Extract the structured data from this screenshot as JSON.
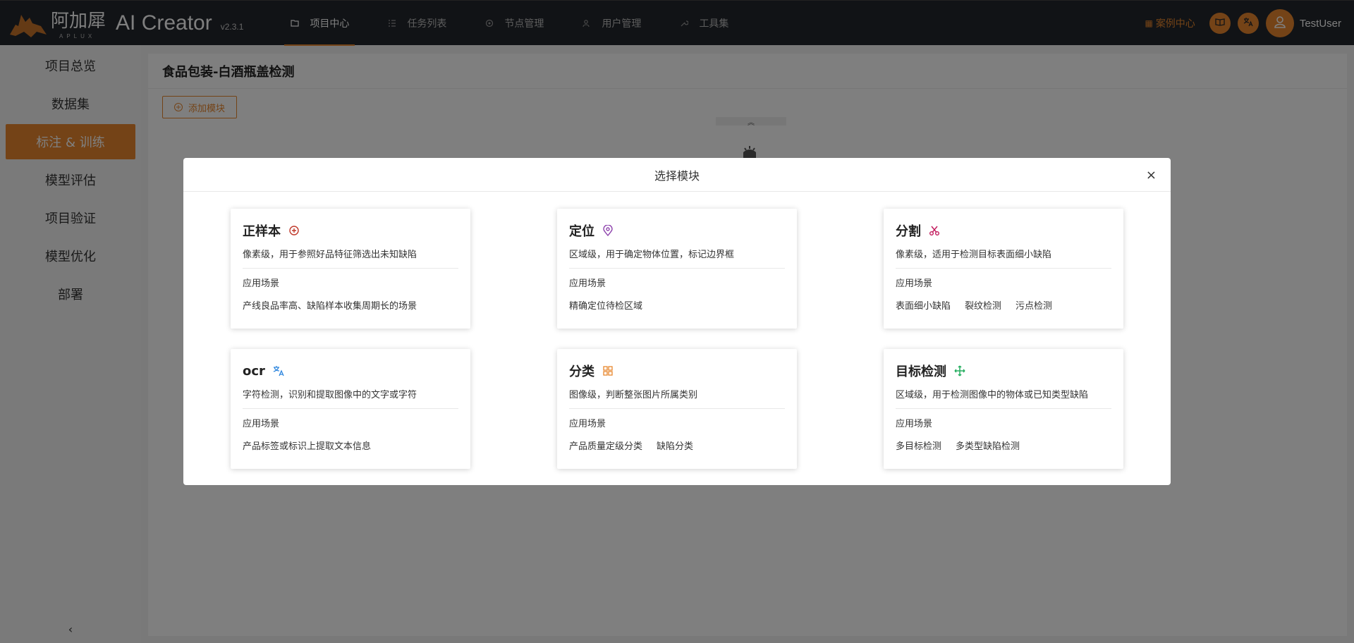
{
  "header": {
    "logo_cn": "阿加犀",
    "logo_sub": "APLUX",
    "app_name": "AI Creator",
    "version": "v2.3.1",
    "nav": [
      {
        "label": "项目中心",
        "icon": "folder-icon",
        "active": true
      },
      {
        "label": "任务列表",
        "icon": "list-icon",
        "active": false
      },
      {
        "label": "节点管理",
        "icon": "node-icon",
        "active": false
      },
      {
        "label": "用户管理",
        "icon": "users-icon",
        "active": false
      },
      {
        "label": "工具集",
        "icon": "wrench-icon",
        "active": false
      }
    ],
    "case_center": "案例中心",
    "username": "TestUser"
  },
  "sidebar": {
    "items": [
      {
        "label": "项目总览",
        "active": false
      },
      {
        "label": "数据集",
        "active": false
      },
      {
        "label": "标注 & 训练",
        "active": true
      },
      {
        "label": "模型评估",
        "active": false
      },
      {
        "label": "项目验证",
        "active": false
      },
      {
        "label": "模型优化",
        "active": false
      },
      {
        "label": "部署",
        "active": false
      }
    ],
    "collapse_glyph": "‹"
  },
  "main": {
    "title": "食品包装-白酒瓶盖检测",
    "add_button": "添加模块"
  },
  "modal": {
    "title": "选择模块",
    "close": "×",
    "scene_label": "应用场景",
    "cards": [
      {
        "title": "正样本",
        "icon": "plus-circle-icon",
        "icon_color": "#c0392b",
        "desc": "像素级，用于参照好品特征筛选出未知缺陷",
        "tags": [
          "产线良品率高、缺陷样本收集周期长的场景"
        ]
      },
      {
        "title": "定位",
        "icon": "location-pin-icon",
        "icon_color": "#8e44ad",
        "desc": "区域级，用于确定物体位置，标记边界框",
        "tags": [
          "精确定位待检区域"
        ]
      },
      {
        "title": "分割",
        "icon": "scissors-icon",
        "icon_color": "#c2185b",
        "desc": "像素级，适用于检测目标表面细小缺陷",
        "tags": [
          "表面细小缺陷",
          "裂纹检测",
          "污点检测"
        ]
      },
      {
        "title": "ocr",
        "icon": "translate-icon",
        "icon_color": "#2e86de",
        "desc": "字符检测，识别和提取图像中的文字或字符",
        "tags": [
          "产品标签或标识上提取文本信息"
        ]
      },
      {
        "title": "分类",
        "icon": "grid-icon",
        "icon_color": "#e8872e",
        "desc": "图像级，判断整张图片所属类别",
        "tags": [
          "产品质量定级分类",
          "缺陷分类"
        ]
      },
      {
        "title": "目标检测",
        "icon": "move-arrows-icon",
        "icon_color": "#27ae60",
        "desc": "区域级，用于检测图像中的物体或已知类型缺陷",
        "tags": [
          "多目标检测",
          "多类型缺陷检测"
        ]
      }
    ]
  }
}
